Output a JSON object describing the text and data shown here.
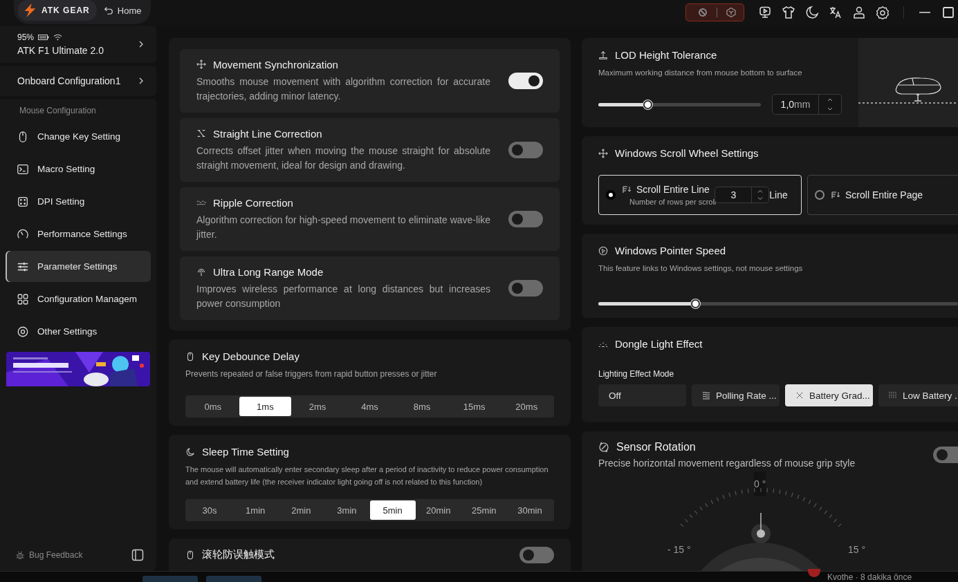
{
  "header": {
    "brand": "ATK GEAR",
    "home": "Home"
  },
  "device": {
    "battery": "95%",
    "name": "ATK F1 Ultimate 2.0"
  },
  "config": {
    "name": "Onboard Configuration1"
  },
  "nav_heading": "Mouse Configuration",
  "nav": [
    {
      "label": "Change Key Setting",
      "kind": "mouse",
      "selected": false
    },
    {
      "label": "Macro Setting",
      "kind": "terminal",
      "selected": false
    },
    {
      "label": "DPI Setting",
      "kind": "dice",
      "selected": false
    },
    {
      "label": "Performance Settings",
      "kind": "gauge",
      "selected": false
    },
    {
      "label": "Parameter Settings",
      "kind": "sliders",
      "selected": true
    },
    {
      "label": "Configuration Managem",
      "kind": "grid",
      "selected": false
    },
    {
      "label": "Other Settings",
      "kind": "gear",
      "selected": false
    }
  ],
  "footer": {
    "feedback": "Bug Feedback"
  },
  "toggles": [
    {
      "kind": "move",
      "title": "Movement Synchronization",
      "description": "Smooths mouse movement with algorithm correction for accurate trajectories, adding minor latency.",
      "on": true
    },
    {
      "kind": "line",
      "title": "Straight Line Correction",
      "description": "Corrects offset jitter when moving the mouse straight for absolute straight movement, ideal for design and drawing.",
      "on": false
    },
    {
      "kind": "wave",
      "title": "Ripple Correction",
      "description": "Algorithm correction for high-speed movement to eliminate wave-like jitter.",
      "on": false
    },
    {
      "kind": "signal",
      "title": "Ultra Long Range Mode",
      "description": "Improves wireless performance at long distances but increases power consumption",
      "on": false
    }
  ],
  "debounce": {
    "title": "Key Debounce Delay",
    "description": "Prevents repeated or false triggers from rapid button presses or jitter",
    "options": [
      {
        "label": "0ms",
        "selected": false
      },
      {
        "label": "1ms",
        "selected": true
      },
      {
        "label": "2ms",
        "selected": false
      },
      {
        "label": "4ms",
        "selected": false
      },
      {
        "label": "8ms",
        "selected": false
      },
      {
        "label": "15ms",
        "selected": false
      },
      {
        "label": "20ms",
        "selected": false
      }
    ]
  },
  "sleep": {
    "title": "Sleep Time Setting",
    "description": "The mouse will automatically enter secondary sleep after a period of inactivity to reduce power consumption and extend battery life (the receiver indicator light going off is not related to this function)",
    "options": [
      {
        "label": "30s",
        "selected": false
      },
      {
        "label": "1min",
        "selected": false
      },
      {
        "label": "2min",
        "selected": false
      },
      {
        "label": "3min",
        "selected": false
      },
      {
        "label": "5min",
        "selected": true
      },
      {
        "label": "20min",
        "selected": false
      },
      {
        "label": "25min",
        "selected": false
      },
      {
        "label": "30min",
        "selected": false
      }
    ]
  },
  "wheel_guard": {
    "title": "滚轮防误触模式",
    "on": false
  },
  "lod": {
    "title": "LOD Height Tolerance",
    "description": "Maximum working distance from mouse bottom to surface",
    "level": 0.3,
    "value": "1,0",
    "unit": "mm"
  },
  "scroll": {
    "title": "Windows Scroll Wheel Settings",
    "options": [
      {
        "title": "Scroll Entire Line",
        "description": "Number of rows per scroll",
        "value": "3",
        "unit": "Line",
        "selected": true
      },
      {
        "title": "Scroll Entire Page",
        "selected": false
      }
    ]
  },
  "pointer": {
    "title": "Windows Pointer Speed",
    "description": "This feature links to Windows settings, not mouse settings",
    "level": 0.27
  },
  "dongle": {
    "title": "Dongle Light Effect",
    "mode_label": "Lighting Effect Mode",
    "modes": [
      {
        "label": "Off",
        "kind": "none",
        "selected": false
      },
      {
        "label": "Polling Rate ...",
        "kind": "wave",
        "selected": false
      },
      {
        "label": "Battery Grad...",
        "kind": "cross",
        "selected": true
      },
      {
        "label": "Low Battery .",
        "kind": "dots",
        "selected": false
      }
    ]
  },
  "sensor": {
    "title": "Sensor Rotation",
    "description": "Precise horizontal movement regardless of mouse grip style",
    "on": false,
    "top_label": "0 °",
    "left_label": "- 15 °",
    "right_label": "15 °"
  },
  "background_window": {
    "text": "Kvothe · 8 dakika önce"
  }
}
